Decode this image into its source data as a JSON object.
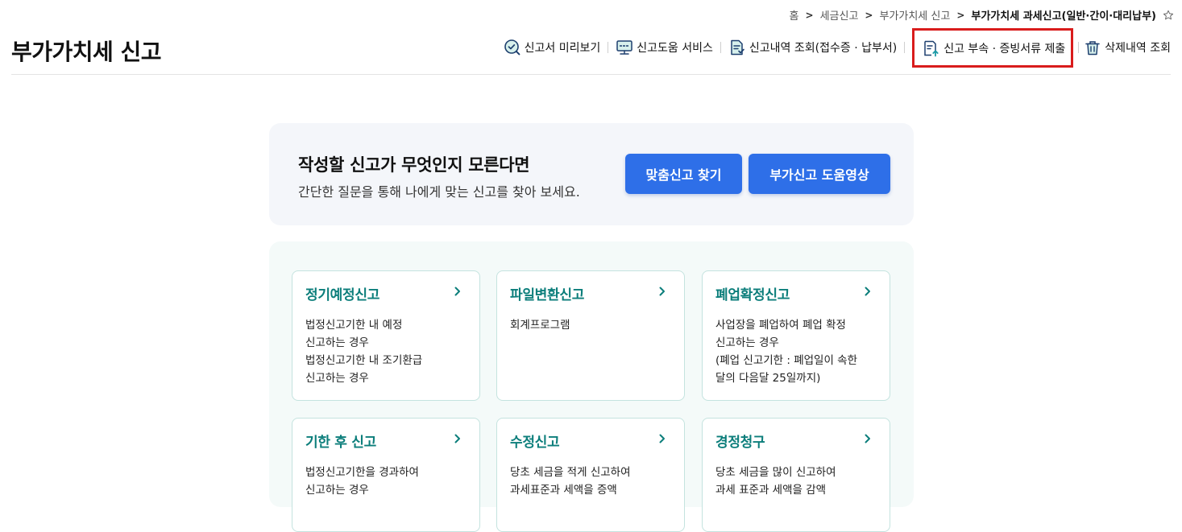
{
  "breadcrumb": {
    "items": [
      "홈",
      "세금신고",
      "부가가치세 신고"
    ],
    "current": "부가가치세 과세신고(일반·간이·대리납부)",
    "separator": ">"
  },
  "page": {
    "title": "부가가치세 신고"
  },
  "toolbar": {
    "items": [
      {
        "label": "신고서 미리보기",
        "icon": "search-doc-icon"
      },
      {
        "label": "신고도움 서비스",
        "icon": "monitor-help-icon"
      },
      {
        "label": "신고내역 조회(접수증 · 납부서)",
        "icon": "document-check-icon"
      },
      {
        "label": "신고 부속 · 증빙서류 제출",
        "icon": "upload-document-icon"
      },
      {
        "label": "삭제내역 조회",
        "icon": "trash-icon"
      }
    ]
  },
  "promo": {
    "title": "작성할 신고가 무엇인지 모른다면",
    "subtitle": "간단한 질문을 통해 나에게 맞는 신고를 찾아 보세요.",
    "button_find": "맞춤신고 찾기",
    "button_video": "부가신고 도움영상"
  },
  "cards": [
    {
      "title": "정기예정신고",
      "desc": [
        "법정신고기한 내 예정",
        "신고하는 경우",
        "법정신고기한 내 조기환급",
        "신고하는 경우"
      ]
    },
    {
      "title": "파일변환신고",
      "desc": [
        "회계프로그램"
      ]
    },
    {
      "title": "폐업확정신고",
      "desc": [
        "사업장을 폐업하여 폐업 확정",
        "신고하는 경우",
        "(폐업 신고기한 : 폐업일이 속한",
        "달의 다음달 25일까지)"
      ]
    },
    {
      "title": "기한 후 신고",
      "desc": [
        "법정신고기한을 경과하여",
        "신고하는 경우"
      ]
    },
    {
      "title": "수정신고",
      "desc": [
        "당초 세금을 적게 신고하여",
        "과세표준과 세액을 증액"
      ]
    },
    {
      "title": "경정청구",
      "desc": [
        "당초 세금을 많이 신고하여",
        "과세 표준과 세액을 감액"
      ]
    }
  ],
  "colors": {
    "accent": "#2e6fe8",
    "card_title": "#0c7e7b",
    "highlight": "#d91c1c"
  }
}
